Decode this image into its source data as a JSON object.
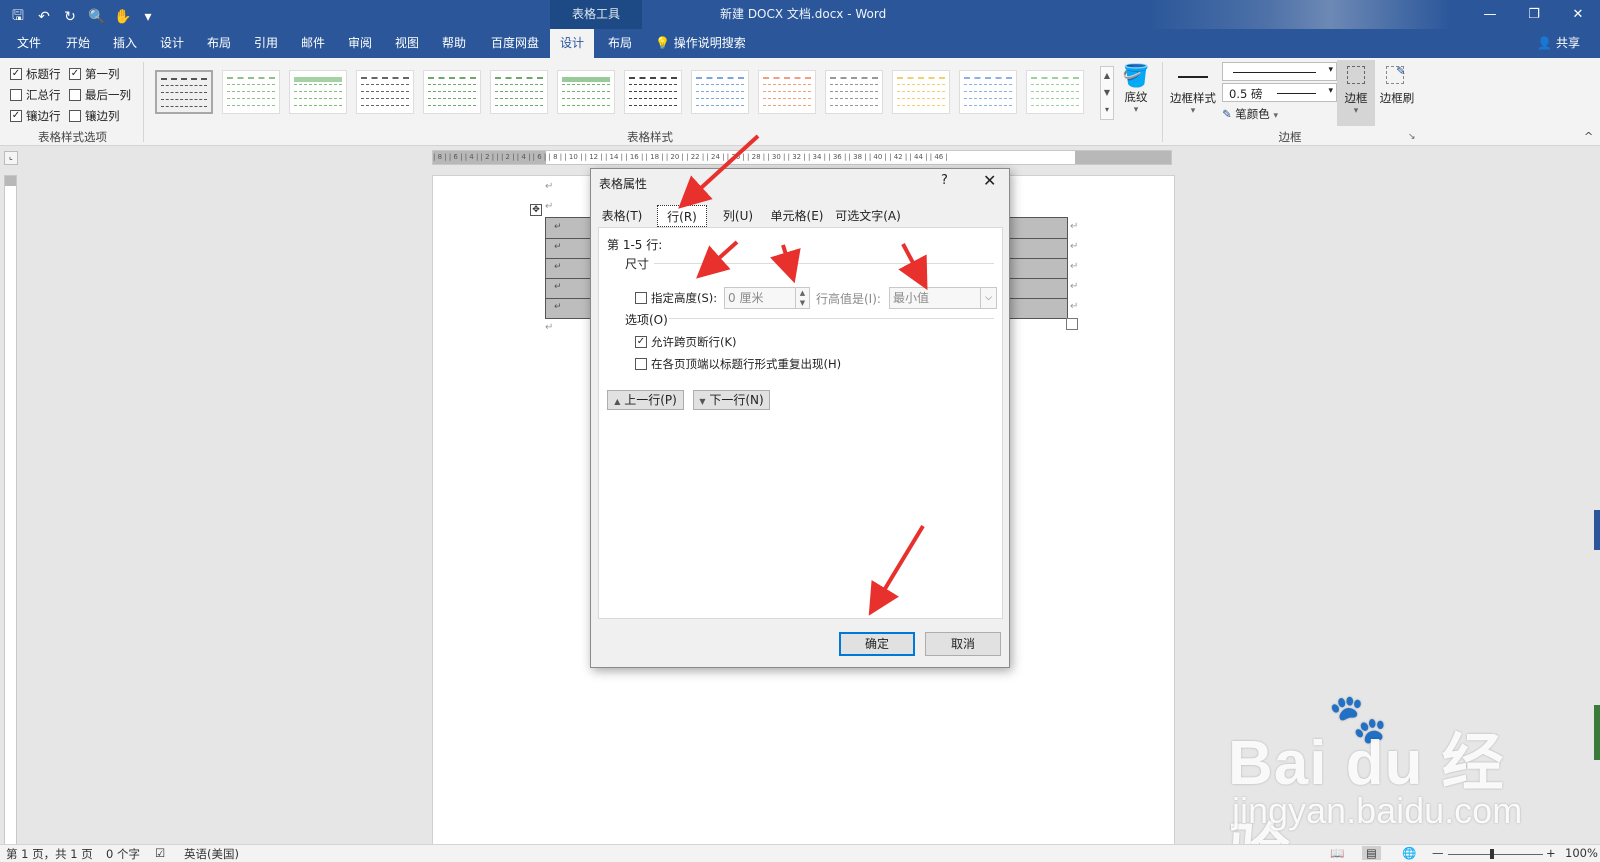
{
  "title_bar": {
    "qat_icons": [
      "save-icon",
      "undo-icon",
      "redo-icon",
      "print-preview-icon",
      "touch-mode-icon",
      "customize-icon"
    ],
    "qat_glyphs": [
      "🖫",
      "↶",
      "↻",
      "🔍",
      "✋",
      "▾"
    ],
    "context_group": "表格工具",
    "document_title": "新建 DOCX 文档.docx  -  Word",
    "window_buttons": [
      "—",
      "❐",
      "✕"
    ]
  },
  "ribbon_tabs": {
    "file": "文件",
    "home": "开始",
    "insert": "插入",
    "design": "设计",
    "layout": "布局",
    "references": "引用",
    "mailings": "邮件",
    "review": "审阅",
    "view": "视图",
    "help": "帮助",
    "baidu": "百度网盘",
    "table_design": "设计",
    "table_layout": "布局",
    "tell_me": "操作说明搜索",
    "share": "共享"
  },
  "ribbon": {
    "style_options": {
      "header_row": {
        "label": "标题行",
        "checked": "✓"
      },
      "first_column": {
        "label": "第一列",
        "checked": "✓"
      },
      "total_row": {
        "label": "汇总行",
        "checked": ""
      },
      "last_column": {
        "label": "最后一列",
        "checked": ""
      },
      "banded_rows": {
        "label": "镶边行",
        "checked": "✓"
      },
      "banded_columns": {
        "label": "镶边列",
        "checked": ""
      },
      "group_label": "表格样式选项"
    },
    "table_styles": {
      "group_label": "表格样式",
      "scroll_glyphs": [
        "▲",
        "▼",
        "▾"
      ],
      "thumb_colors": [
        "#555555",
        "#8fbf8f",
        "#7fbf7f",
        "#666666",
        "#6fa86f",
        "#6fa86f",
        "#6fb56f",
        "#444444",
        "#7ea6d8",
        "#f0a080",
        "#999999",
        "#f0d070",
        "#8fb0e0",
        "#9fd09f"
      ]
    },
    "shading": {
      "label": "底纹",
      "dropdown": "▾"
    },
    "borders": {
      "border_styles_label": "边框样式",
      "pen_weight": "0.5 磅",
      "pen_color_label": "笔颜色",
      "borders_label": "边框",
      "border_painter_label": "边框刷",
      "group_label": "边框",
      "dropdown": "▾"
    },
    "collapse_glyph": "^"
  },
  "ruler": {
    "text": "| 8 |  | 6 |  | 4 |  | 2 |     |  | 2 |  | 4 |  | 6 |  | 8 |  | 10 |  | 12 |  | 14 |  | 16 |  | 18 |  | 20 |  | 22 |  | 24 |  | 26 |  | 28 |  | 30 |  | 32 |  | 34 |  | 36 |  | 38 |  | 40 |  | 42 |  | 44 |  | 46 |"
  },
  "document": {
    "paragraph_mark": "↵",
    "table_rows": 5,
    "move_handle": "✥"
  },
  "dialog": {
    "title": "表格属性",
    "help": "?",
    "close": "✕",
    "tabs": {
      "table": "表格(T)",
      "row": "行(R)",
      "column": "列(U)",
      "cell": "单元格(E)",
      "alt_text": "可选文字(A)"
    },
    "rows_heading": "第 1-5 行:",
    "size_section": "尺寸",
    "specify_height": {
      "label": "指定高度(S):",
      "checked": ""
    },
    "height_value": "0 厘米",
    "spin_glyphs": [
      "▲",
      "▼"
    ],
    "row_height_is_label": "行高值是(I):",
    "row_height_is_value": "最小值",
    "combo_arrow": "⌵",
    "options_section": "选项(O)",
    "allow_break": {
      "label": "允许跨页断行(K)",
      "checked": "✓"
    },
    "repeat_header": {
      "label": "在各页顶端以标题行形式重复出现(H)",
      "checked": ""
    },
    "previous_row": "上一行(P)",
    "next_row": "下一行(N)",
    "prev_glyph": "▲",
    "next_glyph": "▼",
    "ok": "确定",
    "cancel": "取消"
  },
  "status_bar": {
    "page": "第 1 页，共 1 页",
    "words": "0 个字",
    "language": "英语(美国)",
    "zoom": "100%",
    "zoom_minus": "—",
    "zoom_plus": "+"
  },
  "watermark": {
    "logo": "Bai du 经验",
    "url": "jingyan.baidu.com"
  },
  "annotation_color": "#e8312c"
}
